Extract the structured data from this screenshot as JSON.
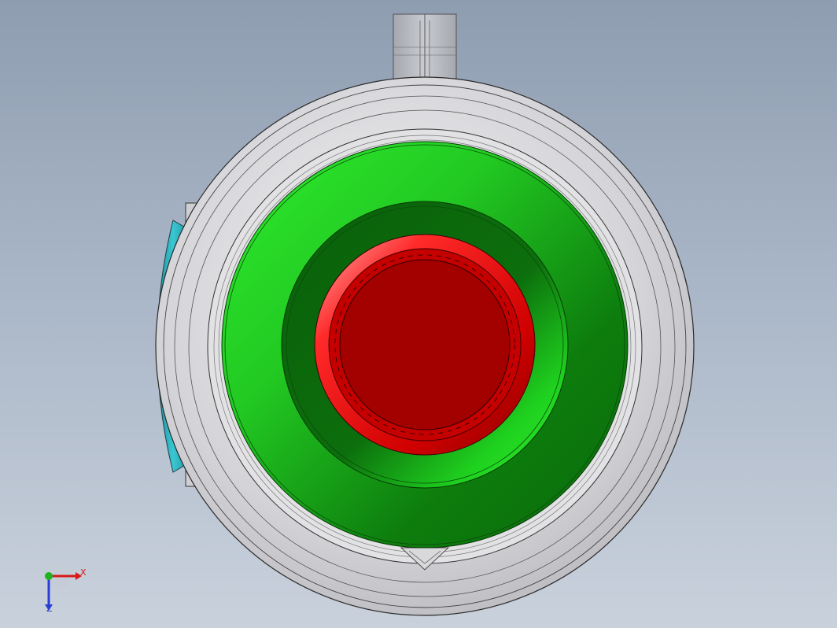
{
  "triad": {
    "x_label": "X",
    "z_label": "Z",
    "colors": {
      "x_axis": "#d81919",
      "y_axis": "#1fb31f",
      "z_axis": "#2a3dd6"
    }
  },
  "model": {
    "view": "top",
    "part_colors": {
      "housing": "#d9d9dc",
      "outer_ring": "#1a9e1a",
      "inner_ring": "#1fdd1f",
      "center_cap": "#a40000",
      "cap_rim": "#ff2020",
      "left_clip": "#2fb9c6",
      "right_tab": "#e4e4e6",
      "top_handle": "#c8c8cc"
    }
  }
}
